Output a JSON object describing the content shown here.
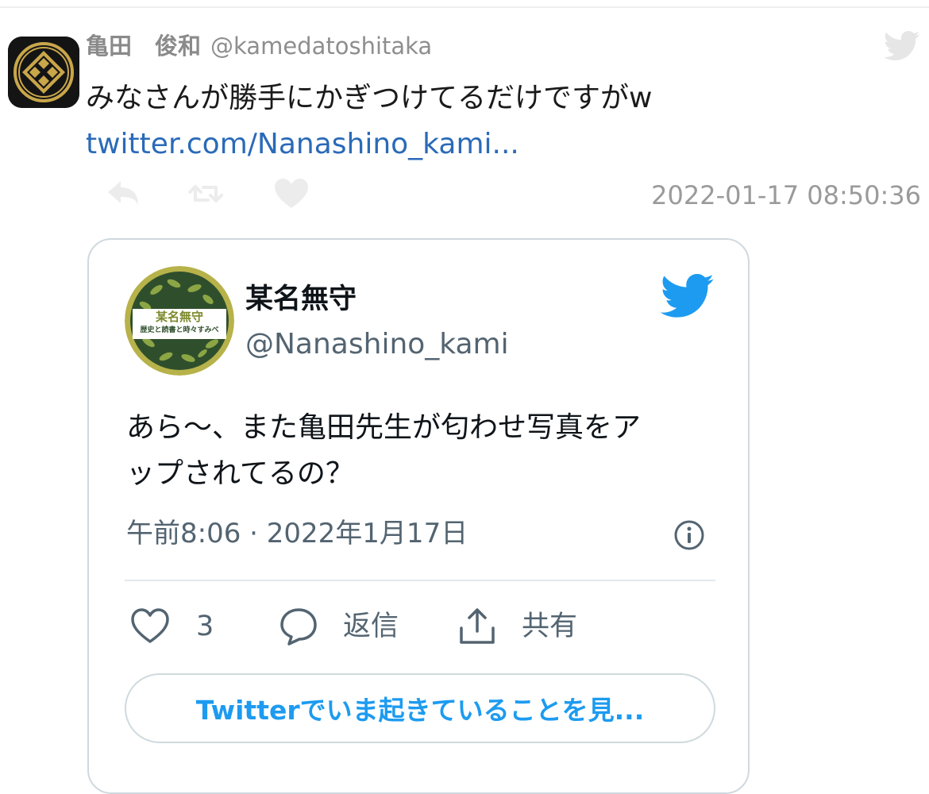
{
  "tweet": {
    "author_name": "亀田　俊和",
    "author_handle": "@kamedatoshitaka",
    "text": "みなさんが勝手にかぎつけてるだけですがw",
    "link": "twitter.com/Nanashino_kami...",
    "timestamp": "2022-01-17 08:50:36",
    "actions": [
      "reply-icon",
      "retweet-icon",
      "like-icon"
    ]
  },
  "embed": {
    "name": "某名無守",
    "handle": "@Nanashino_kami",
    "avatar_text_top": "某名無守",
    "avatar_text_bottom": "歴史と読書と時々すみべ",
    "text_lines": [
      "あら〜、また亀田先生が匂わせ写真をア",
      "ップされてるの？"
    ],
    "meta": "午前8:06 · 2022年1月17日",
    "like_count": "3",
    "reply_label": "返信",
    "share_label": "共有",
    "cta_label": "Twitterでいま起きていることを見..."
  },
  "colors": {
    "link": "#2a6ab8",
    "twitter_blue": "#1d9bf0",
    "muted": "#9a9a9a",
    "card_border": "#cfd9de"
  }
}
